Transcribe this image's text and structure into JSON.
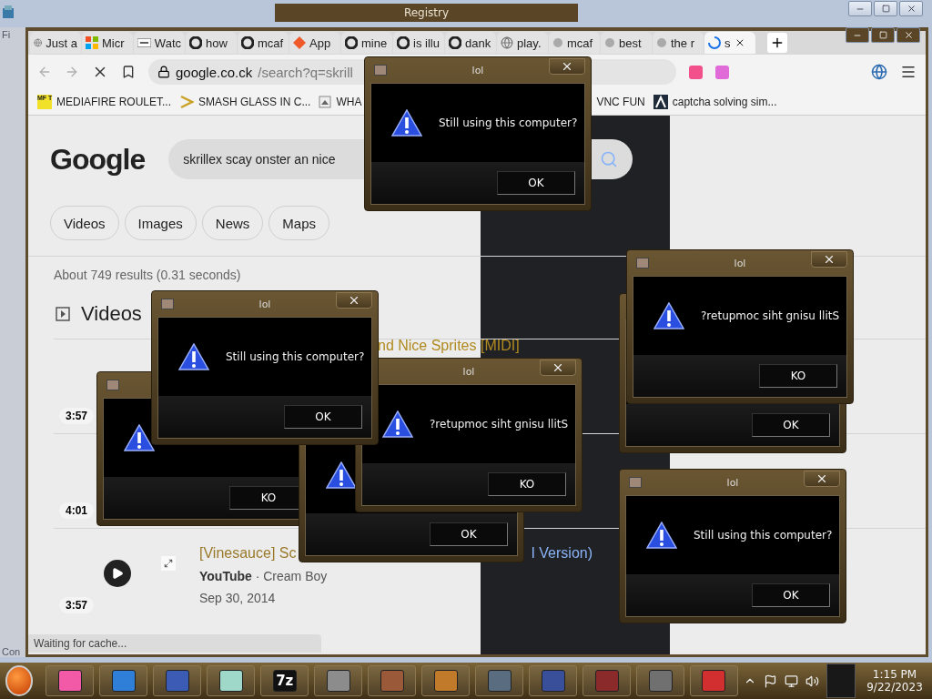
{
  "desktop": {
    "registry_title": "Registry",
    "left_label": "Fi",
    "bottom_label": "Con"
  },
  "browser": {
    "tabs": [
      {
        "label": "Just a",
        "kind": "globe",
        "selected": false
      },
      {
        "label": "Micr",
        "kind": "grid",
        "selected": false
      },
      {
        "label": "Watc",
        "kind": "wide",
        "selected": false
      },
      {
        "label": "how",
        "kind": "google",
        "selected": false
      },
      {
        "label": "mcaf",
        "kind": "google",
        "selected": false
      },
      {
        "label": "App",
        "kind": "spark",
        "selected": false
      },
      {
        "label": "mine",
        "kind": "google",
        "selected": false
      },
      {
        "label": "is illu",
        "kind": "google",
        "selected": false
      },
      {
        "label": "dank",
        "kind": "google",
        "selected": false
      },
      {
        "label": "play.",
        "kind": "globe",
        "selected": false
      },
      {
        "label": "mcaf",
        "kind": "dot",
        "selected": false
      },
      {
        "label": "best",
        "kind": "dot",
        "selected": false
      },
      {
        "label": "the r",
        "kind": "dot",
        "selected": false
      },
      {
        "label": "s",
        "kind": "loading",
        "selected": true
      }
    ],
    "address_host": "google.co.ck",
    "address_path": "/search?q=skrill",
    "bookmarks": [
      {
        "label": "MEDIAFIRE ROULET...",
        "kind": "badge",
        "badge": "MF T"
      },
      {
        "label": "SMASH GLASS IN C...",
        "kind": "chevron"
      },
      {
        "label": "WHA",
        "kind": "page"
      },
      {
        "label": "VNC FUN",
        "kind": "plain"
      },
      {
        "label": "captcha solving sim...",
        "kind": "lambda"
      }
    ],
    "status": "Waiting for cache..."
  },
  "google": {
    "logo": "Google",
    "query": "skrillex scay onster an nice",
    "chips": [
      "Videos",
      "Images",
      "News",
      "Maps"
    ],
    "stats": "About 749 results (0.31 seconds)",
    "section": "Videos",
    "videos": [
      {
        "duration": "3:57",
        "title": "nd Nice Sprites [MIDI]",
        "play": false
      },
      {
        "duration": "4:01",
        "play": false
      },
      {
        "duration": "3:57",
        "title": "[Vinesauce] Sc",
        "title_end": "I Version)",
        "source": "YouTube",
        "channel": "· Cream Boy",
        "date": "Sep 30, 2014",
        "play": true
      }
    ]
  },
  "dialogs": [
    {
      "kind": "warning",
      "button": "KO"
    },
    {
      "kind": "warning",
      "button": "OK",
      "app_icon": false,
      "close": false
    },
    {
      "title": "lol",
      "kind": "warning",
      "message": "?retupmoc siht gnisu llitS",
      "button": "KO",
      "app_icon": false
    },
    {
      "title": "lol",
      "kind": "warning",
      "message": "Still using this computer?",
      "button": "OK"
    },
    {
      "kind": "plain",
      "button": "OK",
      "app_icon": false
    },
    {
      "title": "lol",
      "kind": "warning",
      "message": "?retupmoc siht gnisu llitS",
      "button": "KO"
    },
    {
      "title": "lol",
      "kind": "warning",
      "message": "Still using this computer?",
      "button": "OK"
    },
    {
      "title": "lol",
      "kind": "warning",
      "message": "Still using this computer?",
      "button": "OK"
    }
  ],
  "taskbar": {
    "items": [
      {
        "color": "#f25aa8"
      },
      {
        "color": "#2f7fd8"
      },
      {
        "color": "#3b5bb5"
      },
      {
        "color": "#9fd8c8"
      },
      {
        "color": "#111111",
        "label": "7z"
      },
      {
        "color": "#8c8c8c"
      },
      {
        "color": "#9a5a3a"
      },
      {
        "color": "#c07a2a"
      },
      {
        "color": "#5a6c80"
      },
      {
        "color": "#3a4f9a"
      },
      {
        "color": "#8a2a2a"
      },
      {
        "color": "#707070"
      },
      {
        "color": "#d23030"
      }
    ],
    "time": "1:15 PM",
    "date": "9/22/2023"
  }
}
